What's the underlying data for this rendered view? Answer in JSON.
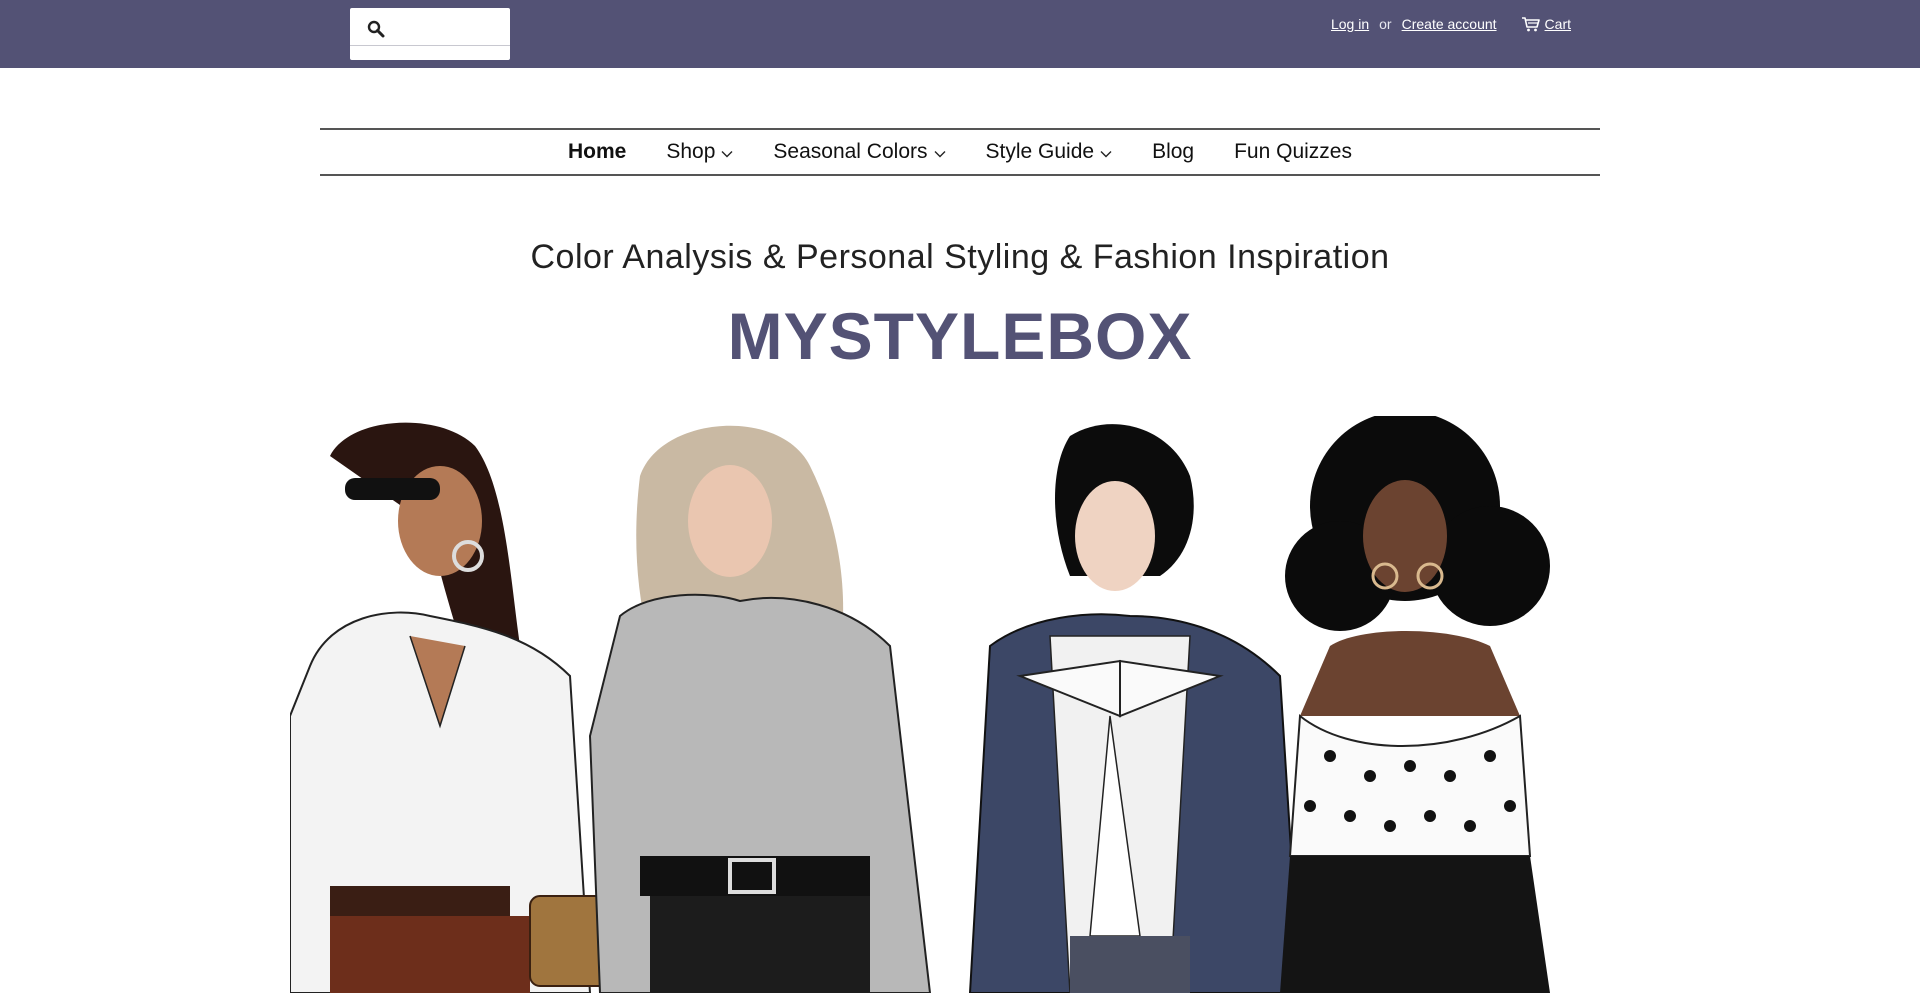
{
  "header": {
    "search": {
      "placeholder": "",
      "value": ""
    },
    "login_label": "Log in",
    "or_label": "or",
    "create_account_label": "Create account",
    "cart_label": "Cart"
  },
  "nav": {
    "items": [
      {
        "label": "Home",
        "dropdown": false,
        "active": true
      },
      {
        "label": "Shop",
        "dropdown": true,
        "active": false
      },
      {
        "label": "Seasonal Colors",
        "dropdown": true,
        "active": false
      },
      {
        "label": "Style Guide",
        "dropdown": true,
        "active": false
      },
      {
        "label": "Blog",
        "dropdown": false,
        "active": false
      },
      {
        "label": "Fun Quizzes",
        "dropdown": false,
        "active": false
      }
    ]
  },
  "hero": {
    "tagline": "Color Analysis & Personal Styling & Fashion Inspiration",
    "brand": "MYSTYLEBOX",
    "image_description_icon": "fashion-illustration-four-women"
  },
  "colors": {
    "topbar": "#535275",
    "brand": "#535275"
  }
}
